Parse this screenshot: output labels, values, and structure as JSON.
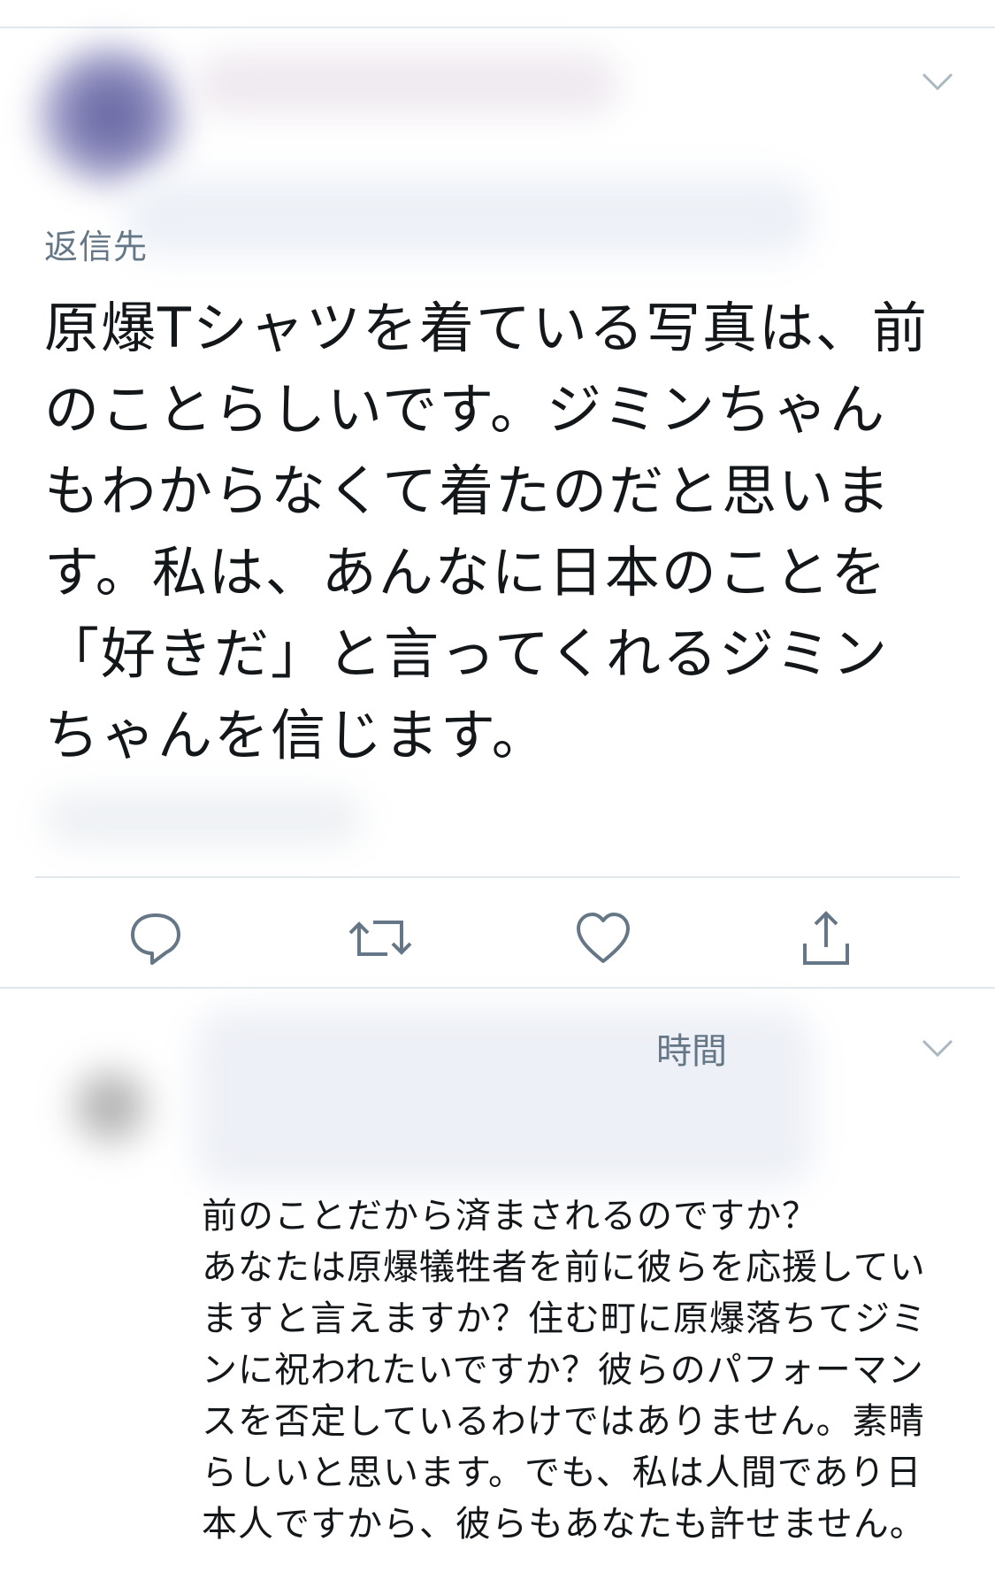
{
  "tweet": {
    "reply_prefix": "返信先",
    "text_lines": [
      "原爆Tシャツを着ている写真は、前",
      "のことらしいです。ジミンちゃん",
      "もわからなくて着たのだと思いま",
      "す。私は、あんなに日本のことを",
      "「好きだ」と言ってくれるジミン",
      "ちゃんを信じます。"
    ],
    "actions": [
      {
        "name": "reply",
        "icon": "reply-icon"
      },
      {
        "name": "retweet",
        "icon": "retweet-icon"
      },
      {
        "name": "like",
        "icon": "heart-icon"
      },
      {
        "name": "share",
        "icon": "share-icon"
      }
    ]
  },
  "reply_tweet": {
    "time_fragment": "時間",
    "text_lines": [
      "前のことだから済まされるのですか？",
      "あなたは原爆犠牲者を前に彼らを応援してい",
      "ますと言えますか？住む町に原爆落ちてジミ",
      "ンに祝われたいですか？彼らのパフォーマン",
      "スを否定しているわけではありません。素晴",
      "らしいと思います。でも、私は人間であり日",
      "本人ですから、彼らもあなたも許せません。"
    ]
  },
  "colors": {
    "text": "#14171a",
    "secondary": "#657786",
    "divider": "#e1e8ed",
    "icon": "#657786"
  }
}
